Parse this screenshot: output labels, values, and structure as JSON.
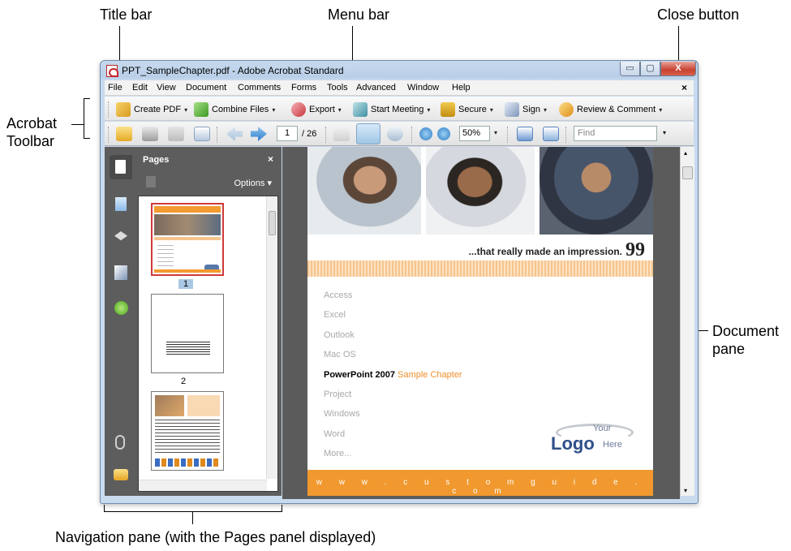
{
  "callouts": {
    "title_bar": "Title bar",
    "menu_bar": "Menu bar",
    "close_button": "Close button",
    "acrobat_toolbar_line1": "Acrobat",
    "acrobat_toolbar_line2": "Toolbar",
    "document_pane_line1": "Document",
    "document_pane_line2": "pane",
    "navigation_pane": "Navigation pane (with the Pages panel displayed)"
  },
  "window": {
    "title": "PPT_SampleChapter.pdf - Adobe Acrobat Standard",
    "min_glyph": "▭",
    "max_glyph": "▢",
    "close_glyph": "X"
  },
  "menu": {
    "items": [
      "File",
      "Edit",
      "View",
      "Document",
      "Comments",
      "Forms",
      "Tools",
      "Advanced",
      "Window",
      "Help"
    ],
    "close_glyph": "×"
  },
  "toolbar": {
    "create_pdf": "Create PDF",
    "combine_files": "Combine Files",
    "export": "Export",
    "start_meeting": "Start Meeting",
    "secure": "Secure",
    "sign": "Sign",
    "review_comment": "Review & Comment",
    "caret": "▾"
  },
  "toolbar2": {
    "page_value": "1",
    "page_total": "/ 26",
    "zoom_value": "50%",
    "find_placeholder": "Find",
    "caret": "▾"
  },
  "pages_panel": {
    "title": "Pages",
    "close": "×",
    "options": "Options ▾",
    "thumb_numbers": [
      "1",
      "2"
    ]
  },
  "document": {
    "quote": "...that really made an impression.",
    "quote_mark": "99",
    "items": [
      "Access",
      "Excel",
      "Outlook",
      "Mac OS"
    ],
    "highlight_main": "PowerPoint 2007",
    "highlight_sub": "Sample Chapter",
    "items_after": [
      "Project",
      "Windows",
      "Word",
      "More..."
    ],
    "logo_your": "Your",
    "logo_main": "Logo",
    "logo_here": "Here",
    "footer": "w w w . c u s t o m g u i d e . c o m"
  },
  "colors": {
    "accent_orange": "#f1992f",
    "nav_dark": "#5d5d5d",
    "window_frame": "#b9cfe8"
  }
}
